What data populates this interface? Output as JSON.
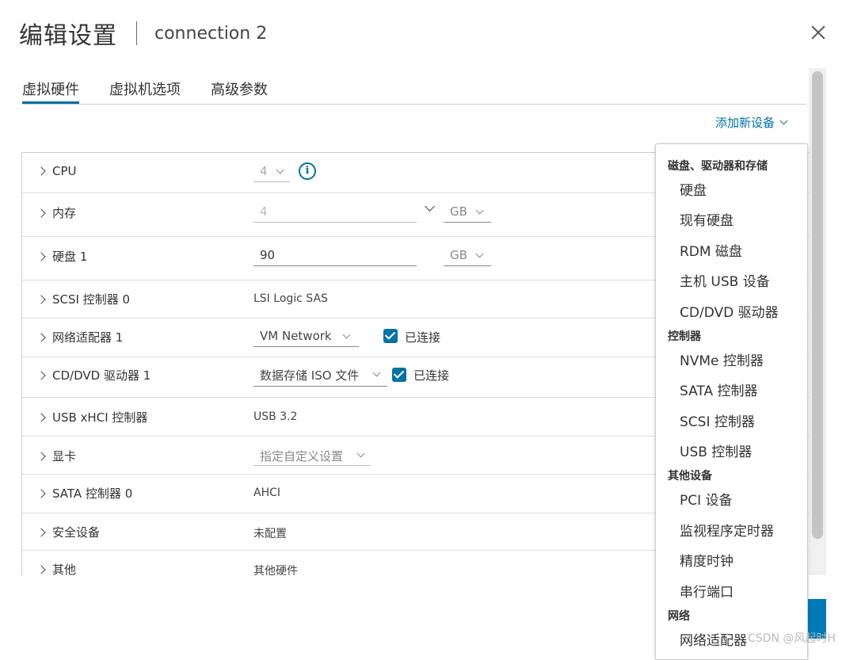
{
  "header": {
    "title": "编辑设置",
    "subtitle": "connection 2"
  },
  "tabs": [
    {
      "label": "虚拟硬件",
      "active": true
    },
    {
      "label": "虚拟机选项",
      "active": false
    },
    {
      "label": "高级参数",
      "active": false
    }
  ],
  "add_device_label": "添加新设备",
  "rows": {
    "cpu": {
      "label": "CPU",
      "value": "4"
    },
    "memory": {
      "label": "内存",
      "value": "4",
      "unit": "GB"
    },
    "disk1": {
      "label": "硬盘 1",
      "value": "90",
      "unit": "GB"
    },
    "scsi": {
      "label": "SCSI 控制器 0",
      "value": "LSI Logic SAS"
    },
    "network": {
      "label": "网络适配器 1",
      "value": "VM Network",
      "connected_label": "已连接"
    },
    "cddvd": {
      "label": "CD/DVD 驱动器 1",
      "value": "数据存储 ISO 文件",
      "connected_label": "已连接"
    },
    "usb": {
      "label": "USB xHCI 控制器",
      "value": "USB 3.2"
    },
    "video": {
      "label": "显卡",
      "value": "指定自定义设置"
    },
    "sata": {
      "label": "SATA 控制器 0",
      "value": "AHCI"
    },
    "security": {
      "label": "安全设备",
      "value": "未配置"
    },
    "other": {
      "label": "其他",
      "value": "其他硬件"
    }
  },
  "dropdown": {
    "groups": [
      {
        "label": "磁盘、驱动器和存储",
        "items": [
          "硬盘",
          "现有硬盘",
          "RDM 磁盘",
          "主机 USB 设备",
          "CD/DVD 驱动器"
        ]
      },
      {
        "label": "控制器",
        "items": [
          "NVMe 控制器",
          "SATA 控制器",
          "SCSI 控制器",
          "USB 控制器"
        ]
      },
      {
        "label": "其他设备",
        "items": [
          "PCI 设备",
          "监视程序定时器",
          "精度时钟",
          "串行端口"
        ]
      },
      {
        "label": "网络",
        "items": [
          "网络适配器"
        ]
      }
    ]
  },
  "watermark": "CSDN @风起时H",
  "colors": {
    "accent": "#0072a3",
    "primary_button": "#0079b8"
  }
}
